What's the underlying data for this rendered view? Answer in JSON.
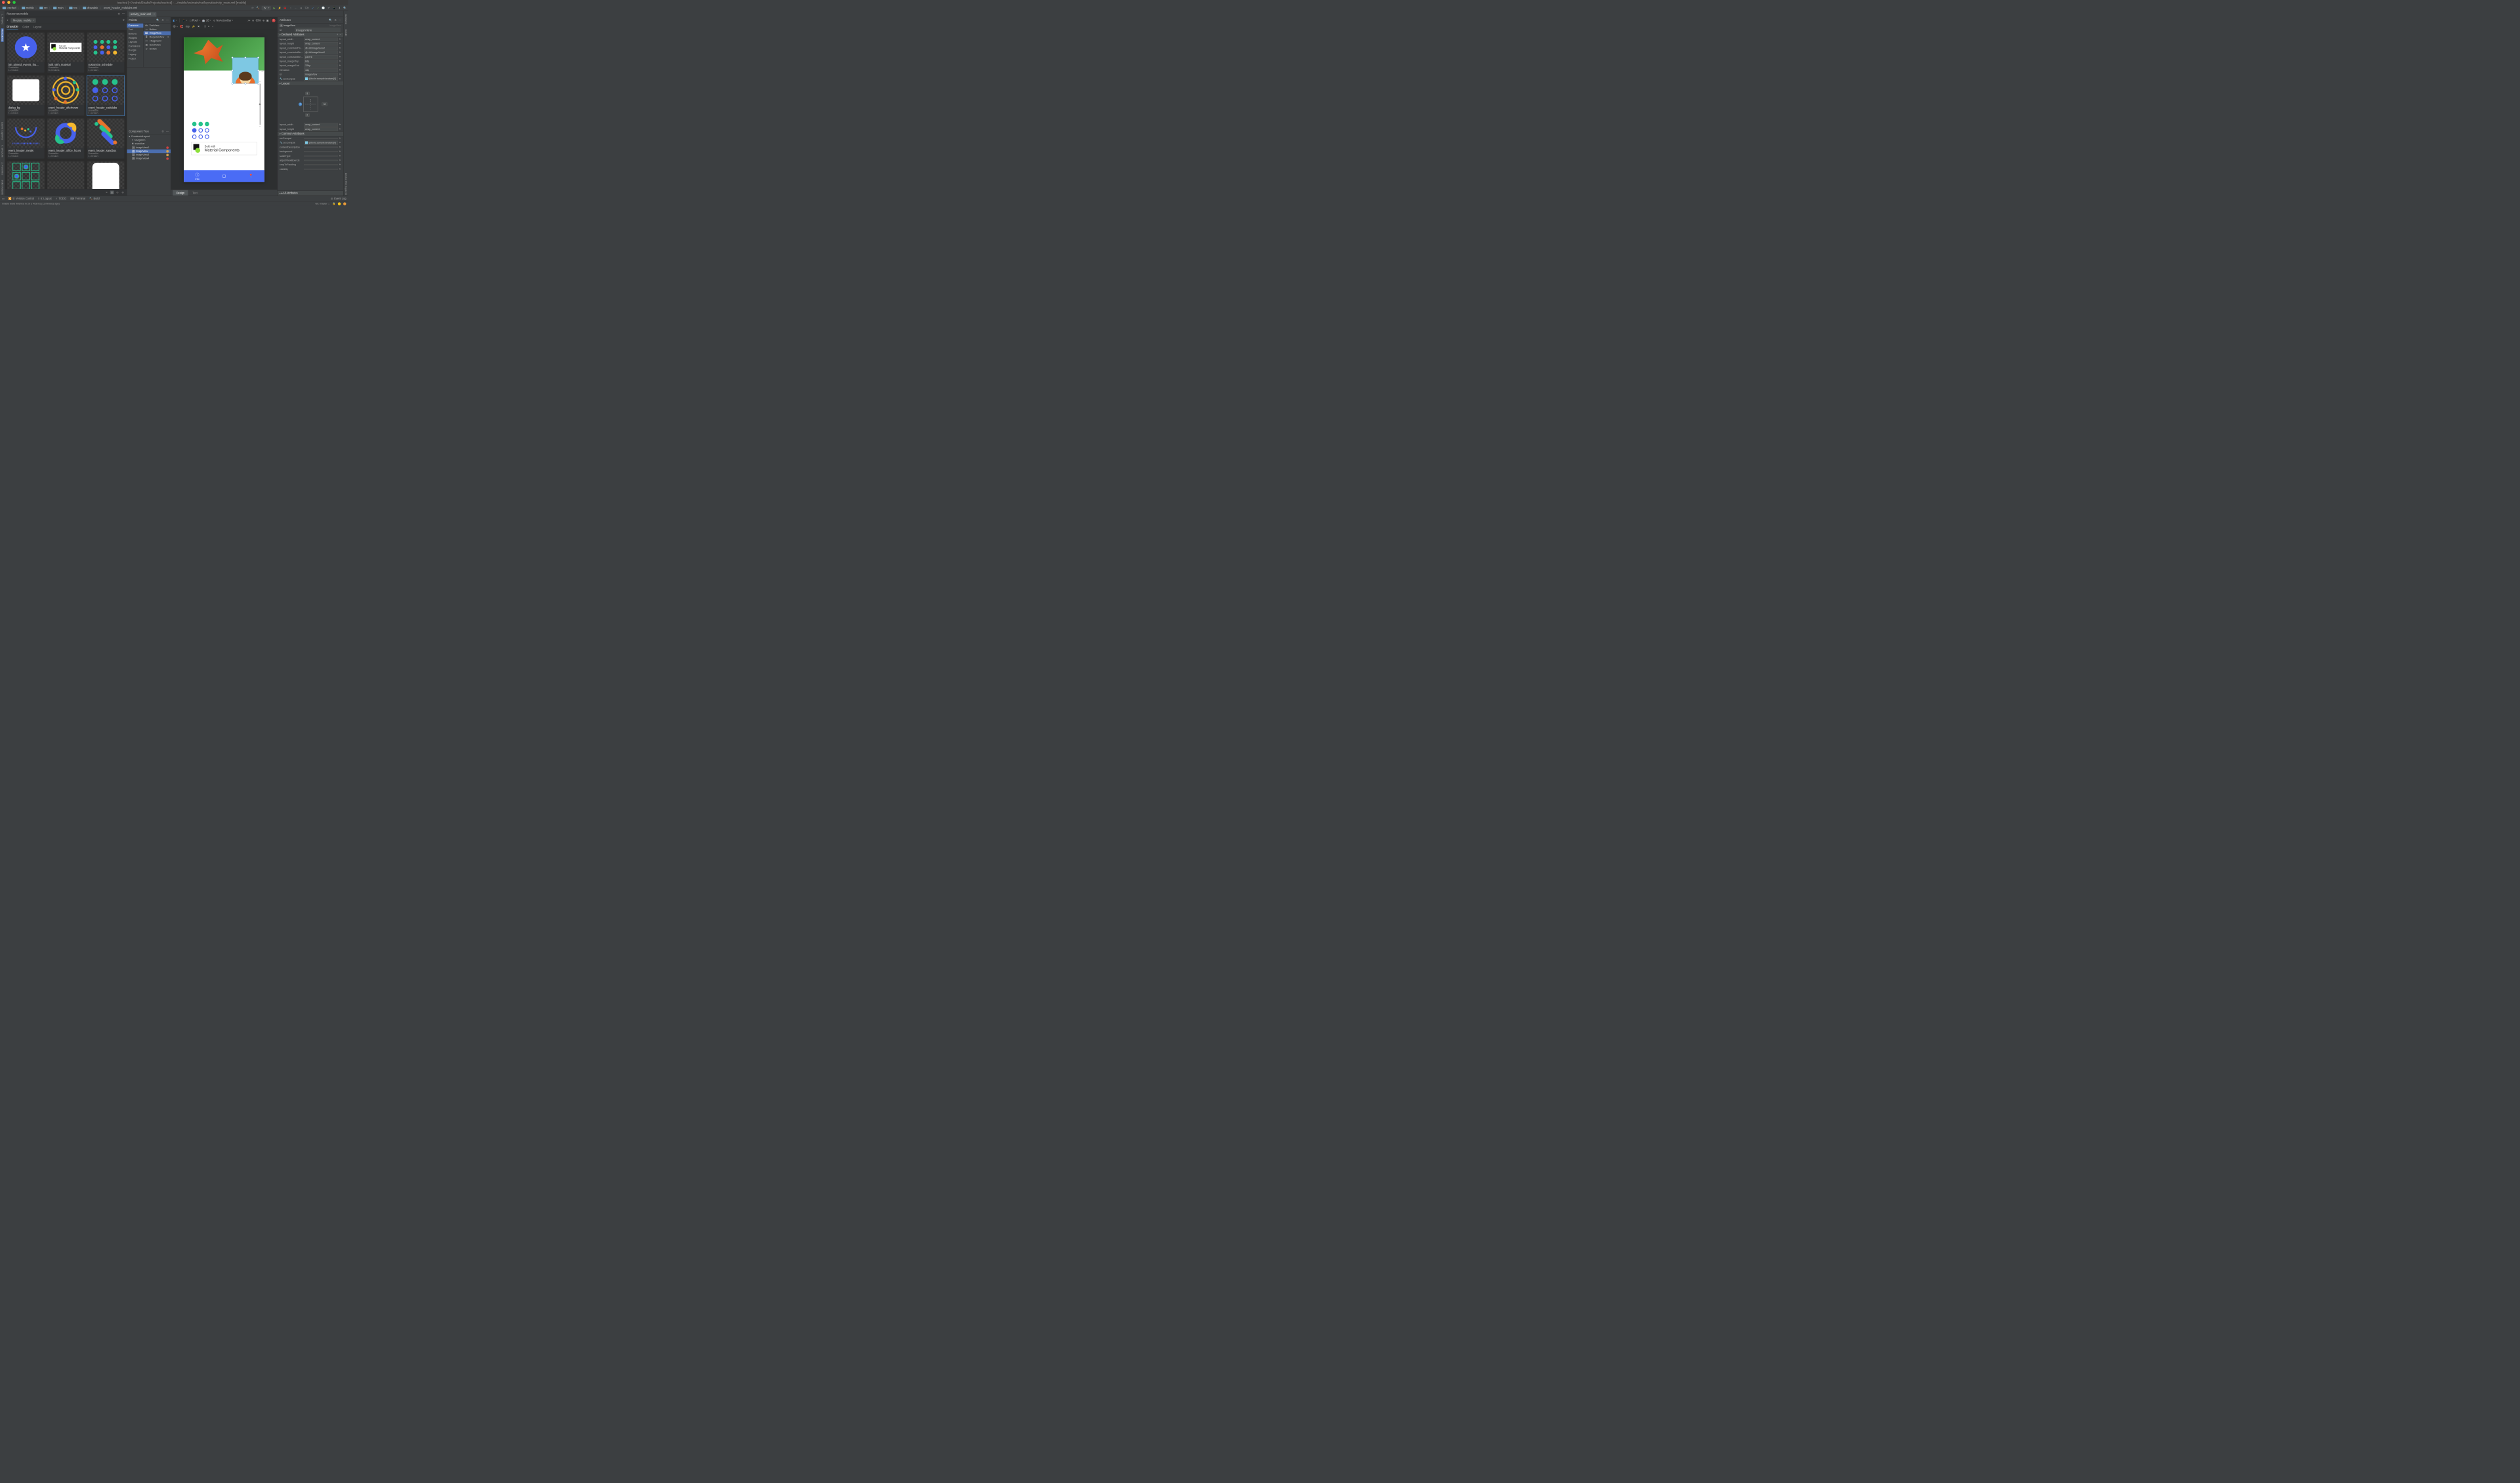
{
  "window": {
    "title": "iosched [~/AndroidStudioProjects/iosched] - .../mobile/src/main/res/layout/activity_main.xml [mobile]"
  },
  "breadcrumb": {
    "items": [
      "iosched",
      "mobile",
      "src",
      "main",
      "res",
      "drawable",
      "event_header_codelabs.xml"
    ]
  },
  "toolbar_right": {
    "run_config": "tv",
    "vcs_label": "Git:"
  },
  "left_rail": [
    "1: Project",
    "Resources"
  ],
  "right_rail": [
    "Assistant",
    "Gradle"
  ],
  "resources": {
    "title": "Resources  mobile",
    "module_label": "Module: mobile",
    "tabs": {
      "drawable": "Drawable",
      "color": "Color",
      "layout": "Layout"
    },
    "items": [
      {
        "name": "btn_pinned_events_thu...",
        "type": "Drawable",
        "ver": "1 version"
      },
      {
        "name": "built_with_material",
        "type": "Drawable",
        "ver": "5 versions"
      },
      {
        "name": "customize_schedule",
        "type": "Drawable",
        "ver": "1 version"
      },
      {
        "name": "dialog_bg",
        "type": "Drawable",
        "ver": "1 version"
      },
      {
        "name": "event_header_afterhours",
        "type": "Drawable",
        "ver": "1 version"
      },
      {
        "name": "event_header_codelabs",
        "type": "Drawable",
        "ver": "1 version"
      },
      {
        "name": "event_header_meals",
        "type": "Drawable",
        "ver": "1 version"
      },
      {
        "name": "event_header_office_hours",
        "type": "Drawable",
        "ver": "1 version"
      },
      {
        "name": "event_header_sandbox",
        "type": "Drawable",
        "ver": "1 version"
      },
      {
        "name": "",
        "type": "",
        "ver": ""
      },
      {
        "name": "",
        "type": "",
        "ver": ""
      },
      {
        "name": "",
        "type": "",
        "ver": ""
      }
    ]
  },
  "editor": {
    "file_tab": "activity_main.xml",
    "palette": {
      "title": "Palette",
      "categories": [
        "Common",
        "Text",
        "Buttons",
        "Widgets",
        "Layouts",
        "Containers",
        "Google",
        "Legacy",
        "Project"
      ],
      "items": [
        "TextView",
        "Button",
        "ImageView",
        "RecyclerView",
        "<fragment>",
        "ScrollView",
        "Switch"
      ]
    },
    "component_tree": {
      "title": "Component Tree",
      "root": "ConstraintLayout",
      "children": [
        "navigation",
        "snackbar",
        "imageView2",
        "imageView",
        "imageView3",
        "imageView4"
      ]
    },
    "design_toolbar": {
      "device": "Pixel",
      "api": "28",
      "theme": "NoActionBar",
      "zoom": "83%",
      "dp": "8dp"
    },
    "device": {
      "built_with_t1": "Built with",
      "built_with_t2": "Material Components",
      "nav": {
        "info": "Info"
      },
      "sel_dim": "32"
    },
    "modes": {
      "design": "Design",
      "text": "Text"
    }
  },
  "attributes": {
    "title": "Attributes",
    "component_type": "ImageView",
    "component_type_ghost": "ImageView",
    "sections": {
      "declared": "Declared Attributes",
      "layout": "Layout",
      "common": "Common Attributes",
      "all": "All Attributes"
    },
    "id_label": "id",
    "id_val": "imageView",
    "declared": [
      {
        "k": "layout_width",
        "v": "wrap_content"
      },
      {
        "k": "layout_height",
        "v": "wrap_content"
      },
      {
        "k": "layout_constraintTop_toB",
        "v": "@+id/imageView2"
      },
      {
        "k": "layout_constraintBottom",
        "v": "@+id/imageView2"
      },
      {
        "k": "layout_constraintEnd_toE",
        "v": "parent"
      },
      {
        "k": "layout_marginTop",
        "v": "8dp"
      },
      {
        "k": "layout_marginEnd",
        "v": "32dp"
      },
      {
        "k": "elevation",
        "v": "4dp"
      },
      {
        "k": "id",
        "v": "imageView"
      },
      {
        "k": "srcCompat",
        "v": "@tools:sample/avatars[0]"
      }
    ],
    "constraint": {
      "top": "8",
      "right": "32",
      "bottom": "0"
    },
    "layout_size": [
      {
        "k": "layout_width",
        "v": "wrap_content"
      },
      {
        "k": "layout_height",
        "v": "wrap_content"
      }
    ],
    "common": [
      {
        "k": "srcCompat",
        "v": ""
      },
      {
        "k": "srcCompat",
        "v": "@tools:sample/avatars[0]",
        "tool": true
      },
      {
        "k": "contentDescription",
        "v": ""
      },
      {
        "k": "background",
        "v": ""
      },
      {
        "k": "scaleType",
        "v": ""
      },
      {
        "k": "adjustViewBounds",
        "v": ""
      },
      {
        "k": "cropToPadding",
        "v": ""
      },
      {
        "k": "visibility",
        "v": ""
      }
    ]
  },
  "bottom_bar": {
    "items": [
      "9: Version Control",
      "6: Logcat",
      "TODO",
      "Terminal",
      "Build"
    ],
    "event_log": "Event Log"
  },
  "status": {
    "msg": "Gradle build finished in 20 s 403 ms (11 minutes ago)",
    "branch": "Git: master"
  },
  "left_bottom_rail": [
    "Layout Captures",
    "7: Structure",
    "2: Favorites",
    "Build Variants"
  ],
  "right_bottom_rail": [
    "Device File Explorer"
  ]
}
